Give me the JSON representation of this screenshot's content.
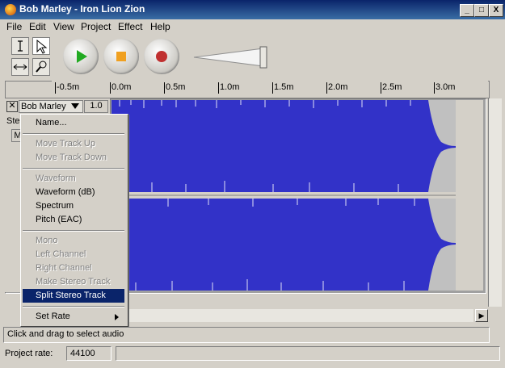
{
  "window": {
    "title": "Bob Marley - Iron Lion Zion",
    "min": "_",
    "max": "□",
    "close": "X"
  },
  "menubar": [
    "File",
    "Edit",
    "View",
    "Project",
    "Effect",
    "Help"
  ],
  "ruler": {
    "labels": [
      "-0.5m",
      "0.0m",
      "0.5m",
      "1.0m",
      "1.5m",
      "2.0m",
      "2.5m",
      "3.0m"
    ]
  },
  "track": {
    "name": "Bob Marley",
    "gain": "1.0",
    "stereo_label": "Ste",
    "mute_label": "M"
  },
  "menu": {
    "items": [
      {
        "label": "Name...",
        "disabled": false
      },
      {
        "label": "Move Track Up",
        "disabled": true
      },
      {
        "label": "Move Track Down",
        "disabled": true
      },
      {
        "label": "Waveform",
        "disabled": true
      },
      {
        "label": "Waveform (dB)",
        "disabled": false
      },
      {
        "label": "Spectrum",
        "disabled": false
      },
      {
        "label": "Pitch (EAC)",
        "disabled": false
      },
      {
        "label": "Mono",
        "disabled": true
      },
      {
        "label": "Left Channel",
        "disabled": true
      },
      {
        "label": "Right Channel",
        "disabled": true
      },
      {
        "label": "Make Stereo Track",
        "disabled": true
      },
      {
        "label": "Split Stereo Track",
        "disabled": false,
        "selected": true
      },
      {
        "label": "Set Rate",
        "disabled": false,
        "submenu": true
      }
    ]
  },
  "status": {
    "text": "Click and drag to select audio",
    "rate_label": "Project rate:",
    "rate_value": "44100"
  },
  "colors": {
    "wave": "#3232c8",
    "titlebar": "#0a246a"
  },
  "icons": {
    "play": "play-icon",
    "stop": "stop-icon",
    "record": "record-icon"
  }
}
